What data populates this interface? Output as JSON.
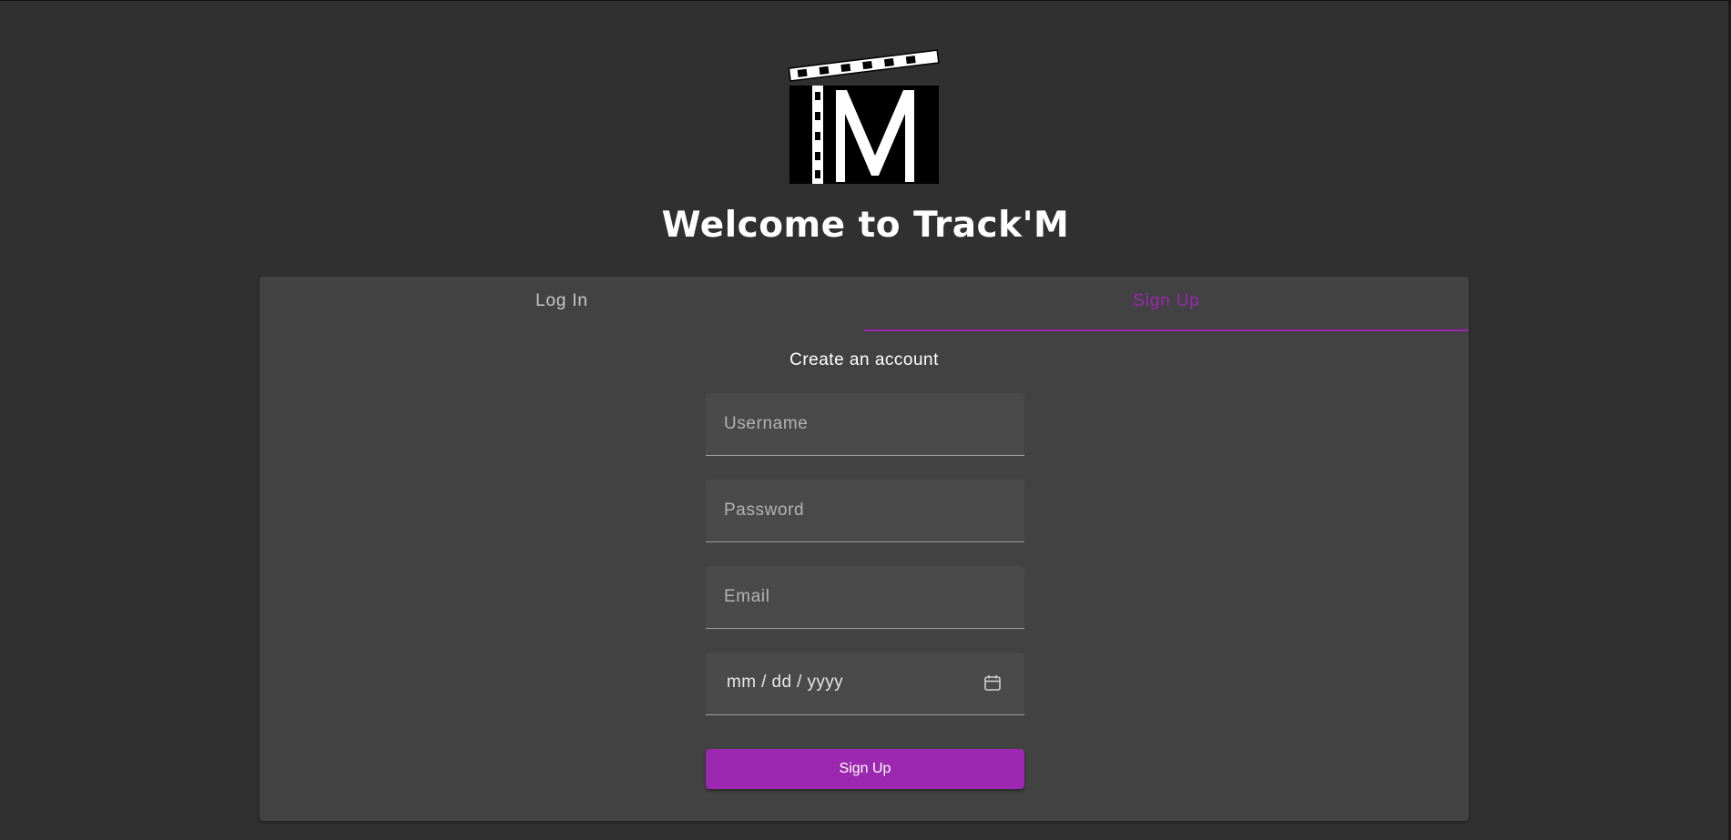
{
  "header": {
    "logo_name": "trackm-logo",
    "title": "Welcome to Track'M"
  },
  "tabs": [
    {
      "label": "Log In",
      "active": false
    },
    {
      "label": "Sign Up",
      "active": true
    }
  ],
  "form": {
    "heading": "Create an account",
    "username": {
      "placeholder": "Username",
      "value": ""
    },
    "password": {
      "placeholder": "Password",
      "value": ""
    },
    "email": {
      "placeholder": "Email",
      "value": ""
    },
    "birthdate": {
      "placeholder": "mm / dd / yyyy",
      "icon": "calendar-icon"
    },
    "submit_label": "Sign Up"
  },
  "colors": {
    "background": "#303030",
    "card": "#424242",
    "accent": "#9c27b0"
  }
}
